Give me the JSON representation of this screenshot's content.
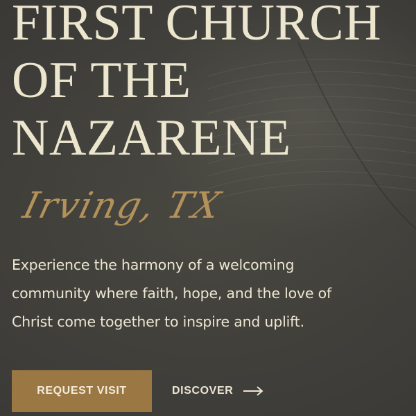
{
  "hero": {
    "title_lines": [
      "FIRST CHURCH",
      "OF THE",
      "NAZARENE"
    ],
    "location": "Irving, TX",
    "tagline_lines": [
      "Experience the harmony of a welcoming",
      "community where faith, hope, and the love of",
      "Christ come together to inspire and uplift."
    ],
    "primary_cta": "REQUEST VISIT",
    "secondary_cta": "DISCOVER",
    "secondary_cta_icon": "arrow-right-icon",
    "colors": {
      "background": "#3d3c39",
      "title": "#ece6cf",
      "script_accent": "#b3915a",
      "button": "#9a7743",
      "text": "#ece6d2"
    }
  }
}
